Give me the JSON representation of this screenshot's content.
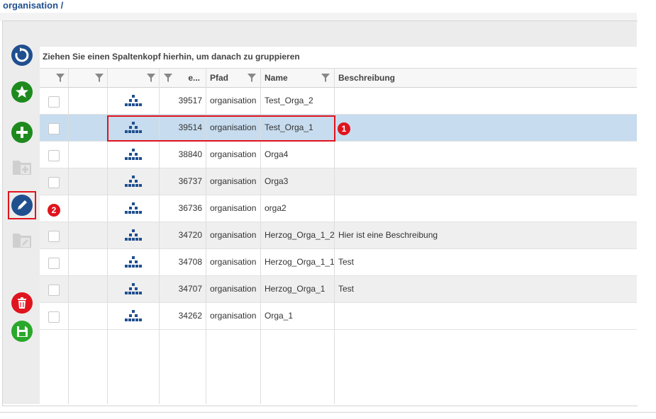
{
  "breadcrumb": "organisation /",
  "toolbar": {
    "buttons": [
      {
        "name": "refresh-button",
        "icon": "refresh-icon",
        "color": "#1f4f8f",
        "enabled": true
      },
      {
        "name": "favorite-button",
        "icon": "star-icon",
        "color": "#1e8a1e",
        "enabled": true
      },
      {
        "name": "add-button",
        "icon": "plus-icon",
        "color": "#1e8a1e",
        "enabled": true
      },
      {
        "name": "add-child-button",
        "icon": "folder-plus-icon",
        "color": "#c8c8c8",
        "enabled": false
      },
      {
        "name": "edit-button",
        "icon": "pencil-icon",
        "color": "#1f4f8f",
        "enabled": true
      },
      {
        "name": "edit-folder-button",
        "icon": "folder-edit-icon",
        "color": "#c8c8c8",
        "enabled": false
      },
      {
        "name": "delete-button",
        "icon": "trash-icon",
        "color": "#e0141e",
        "enabled": true
      },
      {
        "name": "save-button",
        "icon": "floppy-icon",
        "color": "#2aa82a",
        "enabled": true
      }
    ]
  },
  "grid": {
    "group_hint": "Ziehen Sie einen Spaltenkopf hierhin, um danach zu gruppieren",
    "columns": [
      "",
      "",
      "",
      "e...",
      "Pfad",
      "Name",
      "Beschreibung"
    ],
    "rows": [
      {
        "id": "39517",
        "pfad": "organisation",
        "name": "Test_Orga_2",
        "beschreibung": ""
      },
      {
        "id": "39514",
        "pfad": "organisation",
        "name": "Test_Orga_1",
        "beschreibung": ""
      },
      {
        "id": "38840",
        "pfad": "organisation",
        "name": "Orga4",
        "beschreibung": ""
      },
      {
        "id": "36737",
        "pfad": "organisation",
        "name": "Orga3",
        "beschreibung": ""
      },
      {
        "id": "36736",
        "pfad": "organisation",
        "name": "orga2",
        "beschreibung": ""
      },
      {
        "id": "34720",
        "pfad": "organisation",
        "name": "Herzog_Orga_1_2",
        "beschreibung": "Hier ist eine Beschreibung"
      },
      {
        "id": "34708",
        "pfad": "organisation",
        "name": "Herzog_Orga_1_1",
        "beschreibung": "Test"
      },
      {
        "id": "34707",
        "pfad": "organisation",
        "name": "Herzog_Orga_1",
        "beschreibung": "Test"
      },
      {
        "id": "34262",
        "pfad": "organisation",
        "name": "Orga_1",
        "beschreibung": ""
      }
    ],
    "selected_row": 1,
    "row_icon": "org-chart-icon"
  },
  "annotations": {
    "marker1": "1",
    "marker2": "2"
  },
  "colors": {
    "accent": "#1f4f8f",
    "selection": "#c7dcee",
    "highlight": "#e0141e"
  }
}
